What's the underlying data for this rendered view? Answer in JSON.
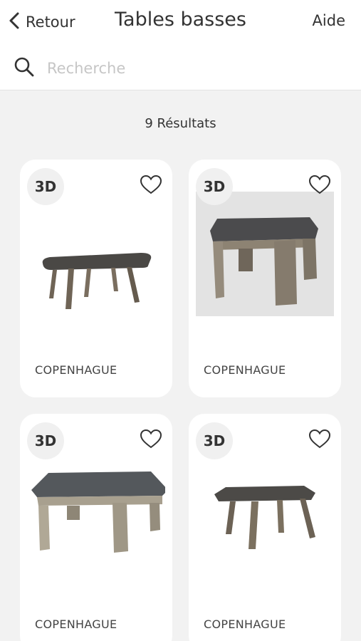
{
  "header": {
    "back_label": "Retour",
    "title": "Tables basses",
    "help_label": "Aide"
  },
  "search": {
    "placeholder": "Recherche",
    "value": ""
  },
  "results": {
    "label": "9 Résultats"
  },
  "products": [
    {
      "badge": "3D",
      "name": "COPENHAGUE",
      "icon": "heart-outline-icon"
    },
    {
      "badge": "3D",
      "name": "COPENHAGUE",
      "icon": "heart-outline-icon"
    },
    {
      "badge": "3D",
      "name": "COPENHAGUE",
      "icon": "heart-outline-icon"
    },
    {
      "badge": "3D",
      "name": "COPENHAGUE",
      "icon": "heart-outline-icon"
    }
  ],
  "colors": {
    "background": "#f2f2f2",
    "card": "#ffffff",
    "text": "#333333",
    "placeholder": "#c6c6c6"
  }
}
